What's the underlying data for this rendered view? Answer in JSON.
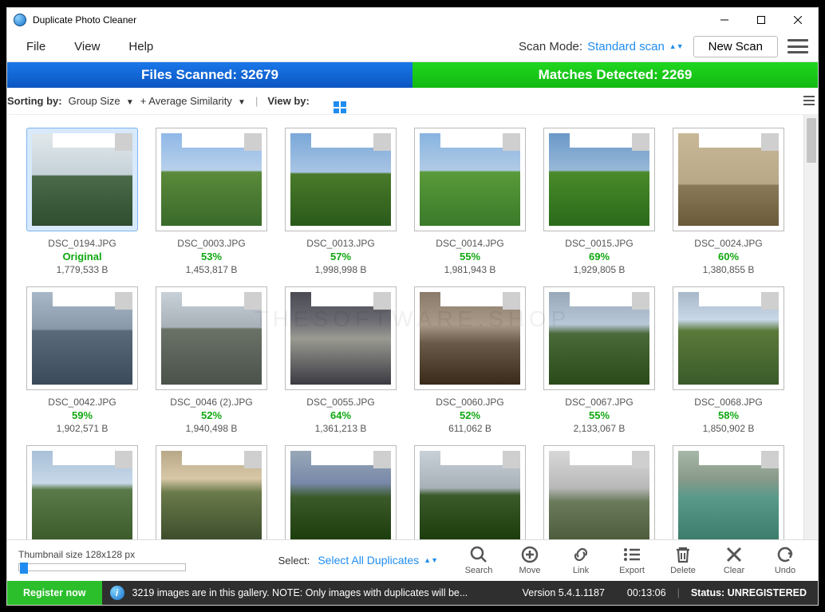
{
  "app_title": "Duplicate Photo Cleaner",
  "menu": {
    "file": "File",
    "view": "View",
    "help": "Help"
  },
  "scan_mode": {
    "label": "Scan Mode:",
    "value": "Standard scan"
  },
  "new_scan": "New Scan",
  "stats": {
    "scanned_label": "Files Scanned: 32679",
    "matches_label": "Matches Detected: 2269"
  },
  "sortbar": {
    "sorting_by": "Sorting by:",
    "opt1": "Group Size",
    "opt2": "+ Average Similarity",
    "view_by": "View by:"
  },
  "watermark": "THESOFTWARE.SHOP",
  "thumbs": [
    {
      "name": "DSC_0194.JPG",
      "sim": "Original",
      "size": "1,779,533 B",
      "cls": "sky1",
      "sel": true
    },
    {
      "name": "DSC_0003.JPG",
      "sim": "53%",
      "size": "1,453,817 B",
      "cls": "sky2"
    },
    {
      "name": "DSC_0013.JPG",
      "sim": "57%",
      "size": "1,998,998 B",
      "cls": "sky3"
    },
    {
      "name": "DSC_0014.JPG",
      "sim": "55%",
      "size": "1,981,943 B",
      "cls": "sky4"
    },
    {
      "name": "DSC_0015.JPG",
      "sim": "69%",
      "size": "1,929,805 B",
      "cls": "sky5"
    },
    {
      "name": "DSC_0024.JPG",
      "sim": "60%",
      "size": "1,380,855 B",
      "cls": "room"
    },
    {
      "name": "DSC_0042.JPG",
      "sim": "59%",
      "size": "1,902,571 B",
      "cls": "sea"
    },
    {
      "name": "DSC_0046 (2).JPG",
      "sim": "52%",
      "size": "1,940,498 B",
      "cls": "town"
    },
    {
      "name": "DSC_0055.JPG",
      "sim": "64%",
      "size": "1,361,213 B",
      "cls": "storm"
    },
    {
      "name": "DSC_0060.JPG",
      "sim": "52%",
      "size": "611,062 B",
      "cls": "dusk"
    },
    {
      "name": "DSC_0067.JPG",
      "sim": "55%",
      "size": "2,133,067 B",
      "cls": "hill"
    },
    {
      "name": "DSC_0068.JPG",
      "sim": "58%",
      "size": "1,850,902 B",
      "cls": "hill2"
    },
    {
      "name": "",
      "sim": "",
      "size": "",
      "cls": "pan1",
      "partial": true
    },
    {
      "name": "",
      "sim": "",
      "size": "",
      "cls": "pan2",
      "partial": true
    },
    {
      "name": "",
      "sim": "",
      "size": "",
      "cls": "pan3",
      "partial": true
    },
    {
      "name": "",
      "sim": "",
      "size": "",
      "cls": "pan4",
      "partial": true
    },
    {
      "name": "",
      "sim": "",
      "size": "",
      "cls": "fog",
      "partial": true
    },
    {
      "name": "",
      "sim": "",
      "size": "",
      "cls": "lake",
      "partial": true
    }
  ],
  "bottom": {
    "thumb_size": "Thumbnail size 128x128 px",
    "select_label": "Select:",
    "select_value": "Select All Duplicates",
    "actions": {
      "search": "Search",
      "move": "Move",
      "link": "Link",
      "export": "Export",
      "delete": "Delete",
      "clear": "Clear",
      "undo": "Undo"
    }
  },
  "status": {
    "register": "Register now",
    "message": "3219 images are in this gallery. NOTE: Only images with duplicates will be...",
    "version": "Version 5.4.1.1187",
    "time": "00:13:06",
    "status": "Status: UNREGISTERED"
  }
}
